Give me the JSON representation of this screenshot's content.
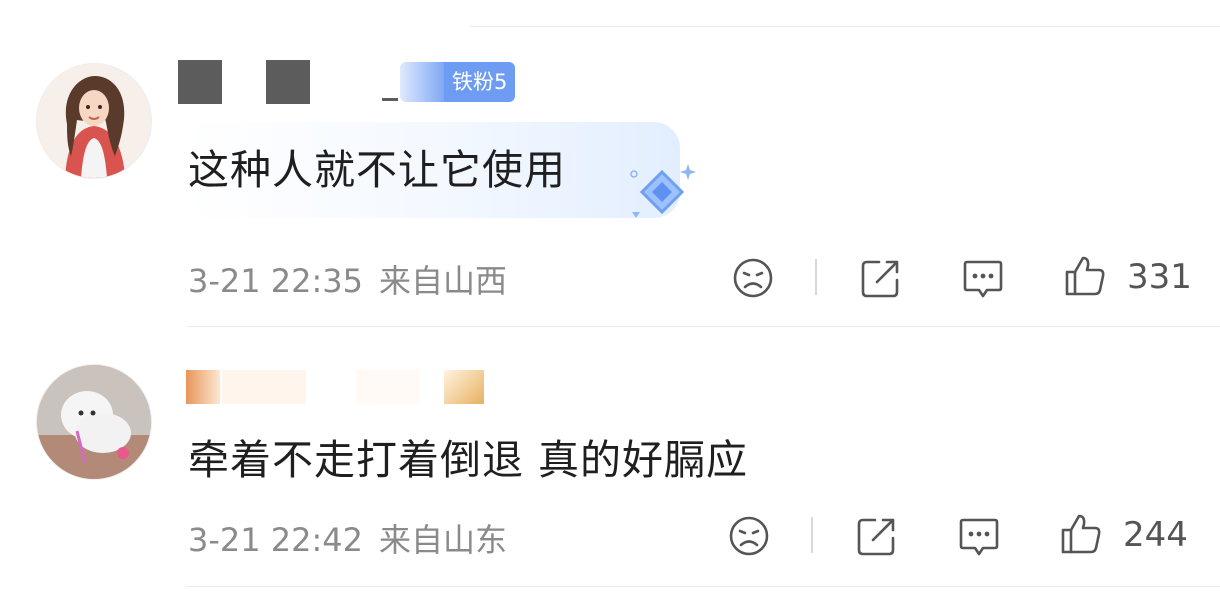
{
  "comments": [
    {
      "username": "",
      "fan_badge": "铁粉5",
      "text": "这种人就不让它使用",
      "time": "3-21 22:35",
      "location": "来自山西",
      "likes": "331",
      "avatar_icon": "girl-avatar",
      "decoration_icon": "gem-sticker-icon"
    },
    {
      "username": "",
      "text": "牵着不走打着倒退 真的好膈应",
      "time": "3-21 22:42",
      "location": "来自山东",
      "likes": "244",
      "avatar_icon": "dog-avatar"
    }
  ],
  "actions": {
    "dislike_icon": "sad-face-icon",
    "share_icon": "share-icon",
    "reply_icon": "comment-bubble-icon",
    "like_icon": "thumbs-up-icon"
  },
  "colors": {
    "fan_badge": "#6e9cf2",
    "meta_text": "#8a8a8a",
    "divider": "#ececec"
  }
}
